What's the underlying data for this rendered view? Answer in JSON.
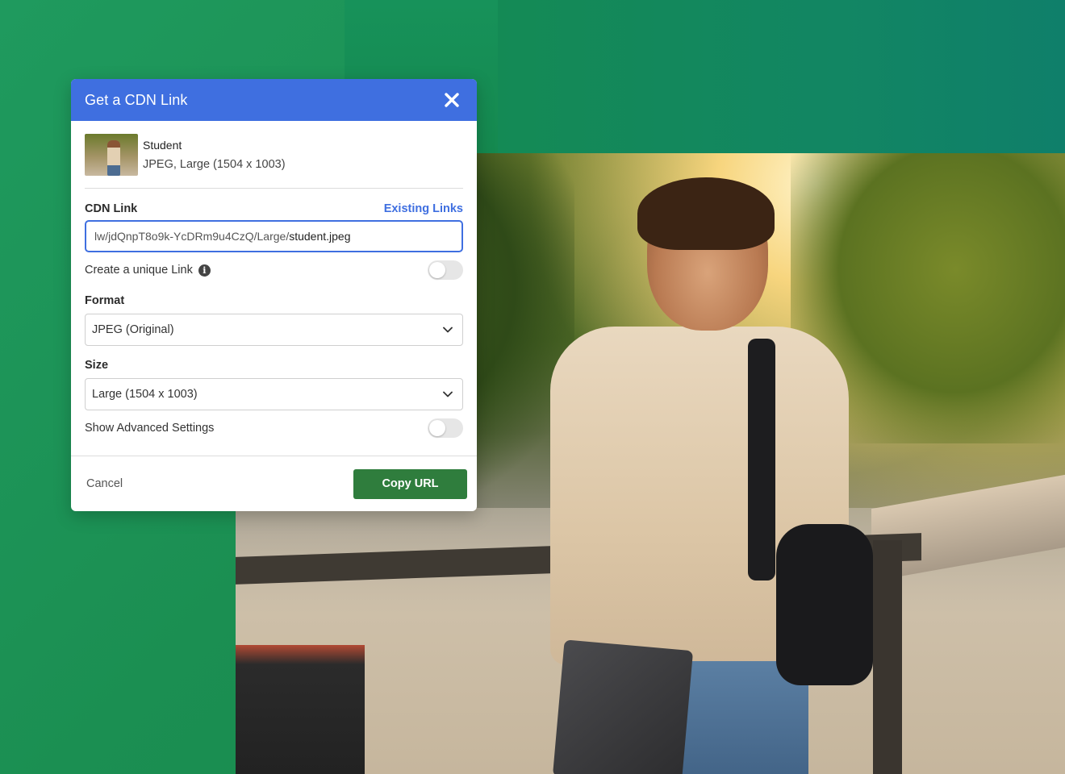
{
  "dialog": {
    "title": "Get a CDN Link",
    "file": {
      "name": "Student",
      "info": "JPEG, Large (1504 x 1003)"
    },
    "cdn_link": {
      "label": "CDN Link",
      "existing_links_label": "Existing Links",
      "value_prefix": "lw/jdQnpT8o9k-YcDRm9u4CzQ/Large/",
      "value_filename": "student.jpeg"
    },
    "unique_link": {
      "label": "Create a unique Link",
      "enabled": false
    },
    "format": {
      "label": "Format",
      "selected": "JPEG (Original)"
    },
    "size": {
      "label": "Size",
      "selected": "Large (1504 x 1003)"
    },
    "advanced": {
      "label": "Show Advanced Settings",
      "enabled": false
    },
    "footer": {
      "cancel_label": "Cancel",
      "copy_label": "Copy URL"
    }
  },
  "colors": {
    "header": "#3f6fe0",
    "primary_button": "#2f7d3d",
    "link": "#3f6fe0"
  },
  "icons": {
    "close": "close-icon",
    "info": "info-icon",
    "chevron": "chevron-down-icon"
  }
}
